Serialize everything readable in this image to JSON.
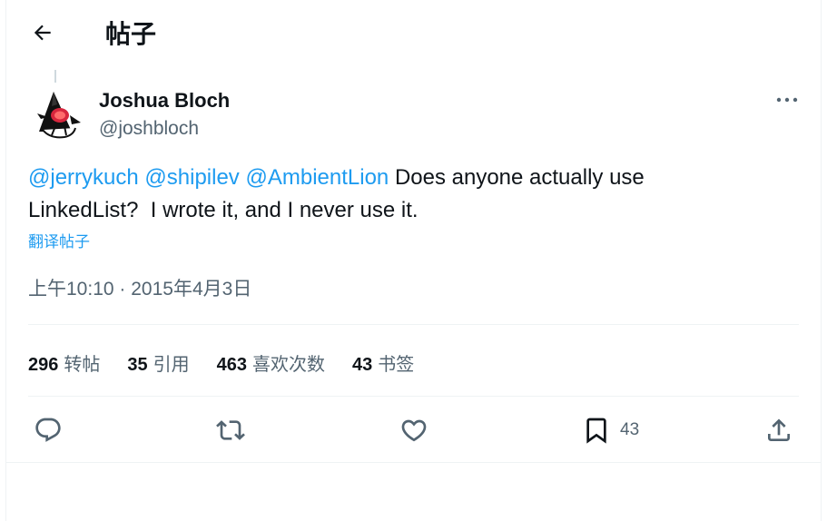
{
  "header": {
    "title": "帖子",
    "back_icon": "arrow-left-icon"
  },
  "author": {
    "name": "Joshua Bloch",
    "handle": "@joshbloch",
    "avatar_icon": "duke-mascot-avatar"
  },
  "tweet": {
    "mentions": [
      "@jerrykuch",
      "@shipilev",
      "@AmbientLion"
    ],
    "body_line1": "Does anyone actually use",
    "body_line2": "LinkedList?  I wrote it, and I never use it.",
    "translate_label": "翻译帖子",
    "time": "上午10:10",
    "separator": "·",
    "date": "2015年4月3日"
  },
  "stats": [
    {
      "count": "296",
      "label": "转帖"
    },
    {
      "count": "35",
      "label": "引用"
    },
    {
      "count": "463",
      "label": "喜欢次数"
    },
    {
      "count": "43",
      "label": "书签"
    }
  ],
  "actions": {
    "reply_icon": "reply-icon",
    "repost_icon": "repost-icon",
    "like_icon": "heart-icon",
    "bookmark_icon": "bookmark-icon",
    "bookmark_count": "43",
    "share_icon": "share-icon"
  },
  "colors": {
    "accent": "#1d9bf0",
    "text": "#0f1419",
    "secondary": "#536471",
    "divider": "#eff3f4"
  }
}
